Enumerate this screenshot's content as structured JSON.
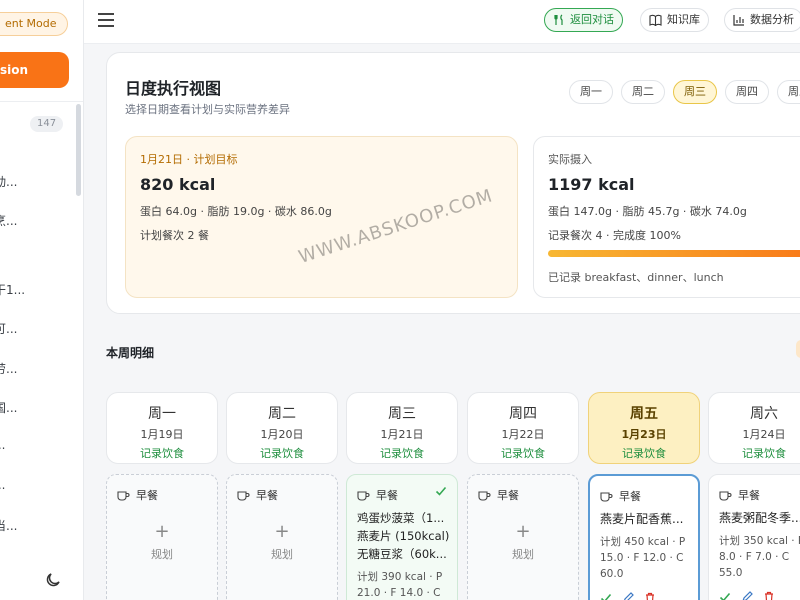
{
  "sidebar": {
    "mode_label": "ent Mode",
    "new_button": "sion",
    "count": "147",
    "items": [
      "动...",
      "烹...",
      "",
      "干1...",
      "可...",
      "劳...",
      "国...",
      "...",
      "...",
      "当..."
    ]
  },
  "topbar": {
    "back_label": "返回对话",
    "kb_label": "知识库",
    "data_label": "数据分析"
  },
  "daily_view": {
    "title": "日度执行视图",
    "subtitle": "选择日期查看计划与实际营养差异",
    "tabs": [
      "周一",
      "周二",
      "周三",
      "周四",
      "周五"
    ],
    "active_tab": "周三",
    "plan": {
      "label": "1月21日 · 计划目标",
      "kcal": "820 kcal",
      "macros": "蛋白 64.0g · 脂肪 19.0g · 碳水 86.0g",
      "meals": "计划餐次 2 餐"
    },
    "actual": {
      "label": "实际摄入",
      "kcal": "1197 kcal",
      "macros": "蛋白 147.0g · 脂肪 45.7g · 碳水 74.0g",
      "meals": "记录餐次 4 · 完成度 100%",
      "progress": 1.0,
      "recorded": "已记录 breakfast、dinner、lunch"
    }
  },
  "week": {
    "title": "本周明细",
    "days": [
      {
        "name": "周一",
        "date": "1月19日",
        "link": "记录饮食"
      },
      {
        "name": "周二",
        "date": "1月20日",
        "link": "记录饮食"
      },
      {
        "name": "周三",
        "date": "1月21日",
        "link": "记录饮食"
      },
      {
        "name": "周四",
        "date": "1月22日",
        "link": "记录饮食"
      },
      {
        "name": "周五",
        "date": "1月23日",
        "link": "记录饮食"
      },
      {
        "name": "周六",
        "date": "1月24日",
        "link": "记录饮食"
      }
    ],
    "meal_label": "早餐",
    "plan_word": "规划",
    "plus": "+",
    "wed_meal": {
      "lines": [
        "鸡蛋炒菠菜（1...",
        "燕麦片 (150kcal)",
        "无糖豆浆（60k..."
      ],
      "plan": "计划 390 kcal · P 21.0 · F 14.0 · C"
    },
    "fri_meal": {
      "title": "燕麦片配香蕉...",
      "plan": "计划 450 kcal · P 15.0 · F 12.0 · C 60.0"
    },
    "sat_meal": {
      "title": "燕麦粥配冬季...",
      "plan": "计划 350 kcal · P 8.0 · F 7.0 · C 55.0"
    }
  },
  "watermark": "WWW.ABSKOOP.COM",
  "colors": {
    "accent": "#f97316",
    "green": "#1e8e3e",
    "active_day": "#fdf0c2",
    "blue_border": "#5b9bd5"
  }
}
